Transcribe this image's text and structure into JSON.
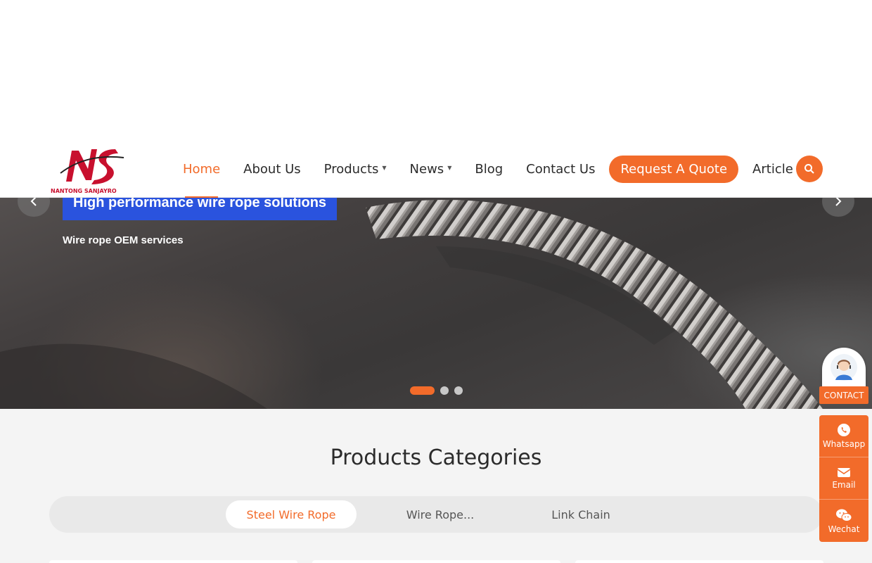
{
  "brand": {
    "logo_text": "NANTONG SANJAYRO",
    "accent": "#f26b2a"
  },
  "nav": {
    "items": [
      {
        "label": "Home",
        "active": true,
        "dropdown": false
      },
      {
        "label": "About Us",
        "active": false,
        "dropdown": false
      },
      {
        "label": "Products",
        "active": false,
        "dropdown": true
      },
      {
        "label": "News",
        "active": false,
        "dropdown": true
      },
      {
        "label": "Blog",
        "active": false,
        "dropdown": false
      },
      {
        "label": "Contact Us",
        "active": false,
        "dropdown": false
      }
    ],
    "quote_button": "Request A Quote",
    "article": "Article",
    "search_icon": "search-icon"
  },
  "hero": {
    "title": "High performance wire rope solutions",
    "subtitle": "Wire rope OEM services",
    "slides": 3,
    "active_slide": 1,
    "title_bg": "#2a53de"
  },
  "categories": {
    "title": "Products Categories",
    "tabs": [
      {
        "label": "Steel Wire Rope",
        "active": true
      },
      {
        "label": "Wire Rope...",
        "active": false
      },
      {
        "label": "Link Chain",
        "active": false
      }
    ]
  },
  "float": {
    "contact_label": "CONTACT",
    "items": [
      {
        "label": "Whatsapp",
        "icon": "whatsapp-icon"
      },
      {
        "label": "Email",
        "icon": "email-icon"
      },
      {
        "label": "Wechat",
        "icon": "wechat-icon"
      }
    ]
  }
}
